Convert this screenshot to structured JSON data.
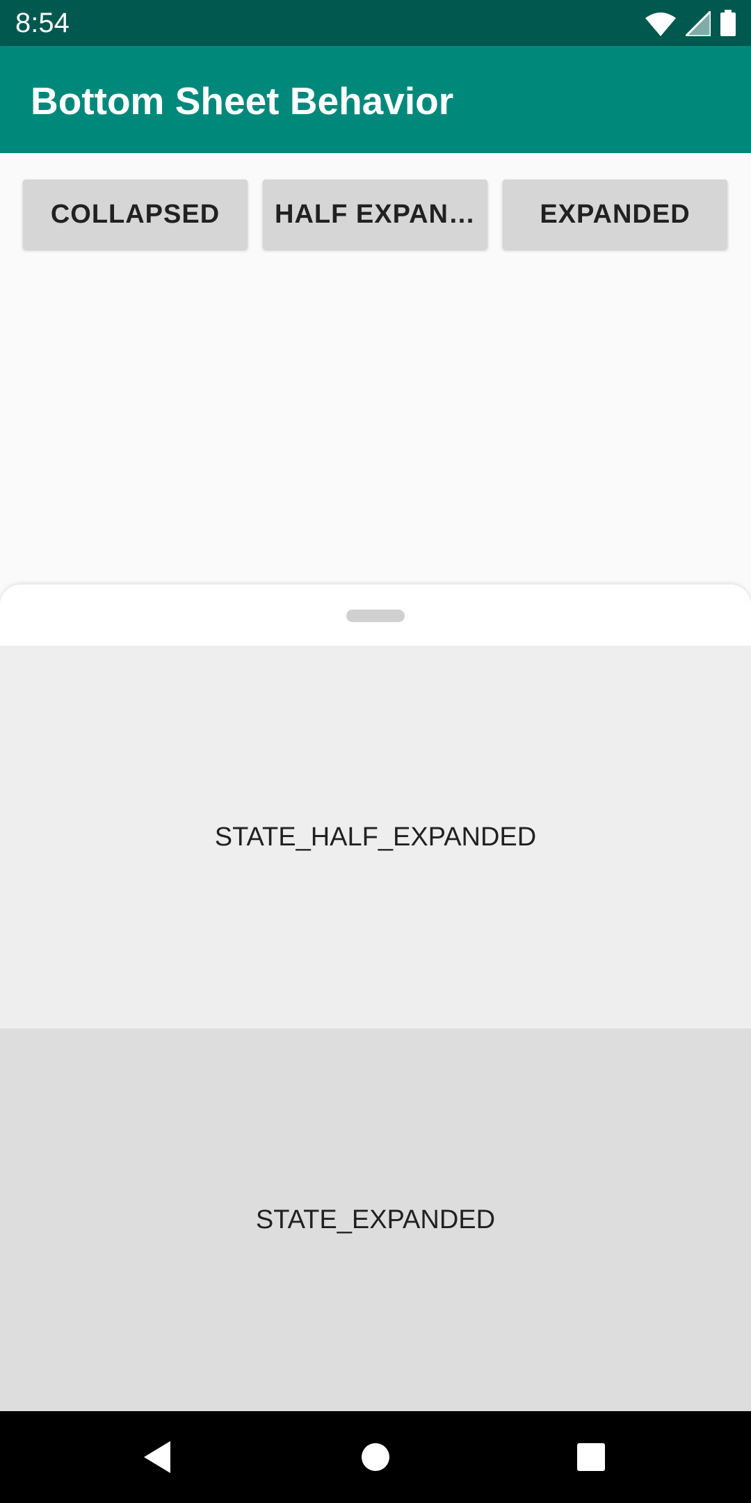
{
  "status_bar": {
    "time": "8:54",
    "icons": [
      "wifi-icon",
      "cell-signal-icon",
      "battery-icon"
    ]
  },
  "app_bar": {
    "title": "Bottom Sheet Behavior",
    "color": "#00897b"
  },
  "buttons": {
    "collapsed": "COLLAPSED",
    "half_expanded": "HALF EXPAN…",
    "expanded": "EXPANDED"
  },
  "bottom_sheet": {
    "half_expanded_label": "STATE_HALF_EXPANDED",
    "expanded_label": "STATE_EXPANDED"
  },
  "nav_bar": {
    "icons": [
      "back-icon",
      "home-icon",
      "recents-icon"
    ]
  }
}
